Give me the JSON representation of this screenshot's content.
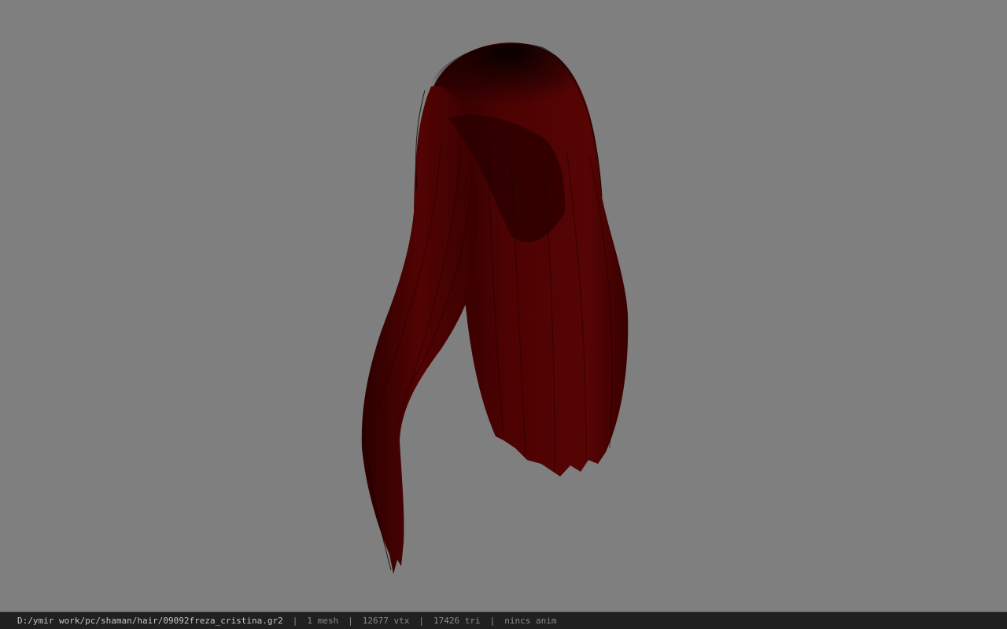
{
  "viewport": {
    "background_color": "#7f7f7f",
    "model": {
      "subject": "hair",
      "color_dark": "#1a0000",
      "color_mid": "#4a0000",
      "color_light": "#5a0404"
    }
  },
  "status_bar": {
    "file_path": "D:/ymir work/pc/shaman/hair/09092freza_cristina.gr2",
    "mesh_count": "1 mesh",
    "vertex_count": "12677 vtx",
    "triangle_count": "17426 tri",
    "anim_status": "nincs anim",
    "separator": "|"
  }
}
